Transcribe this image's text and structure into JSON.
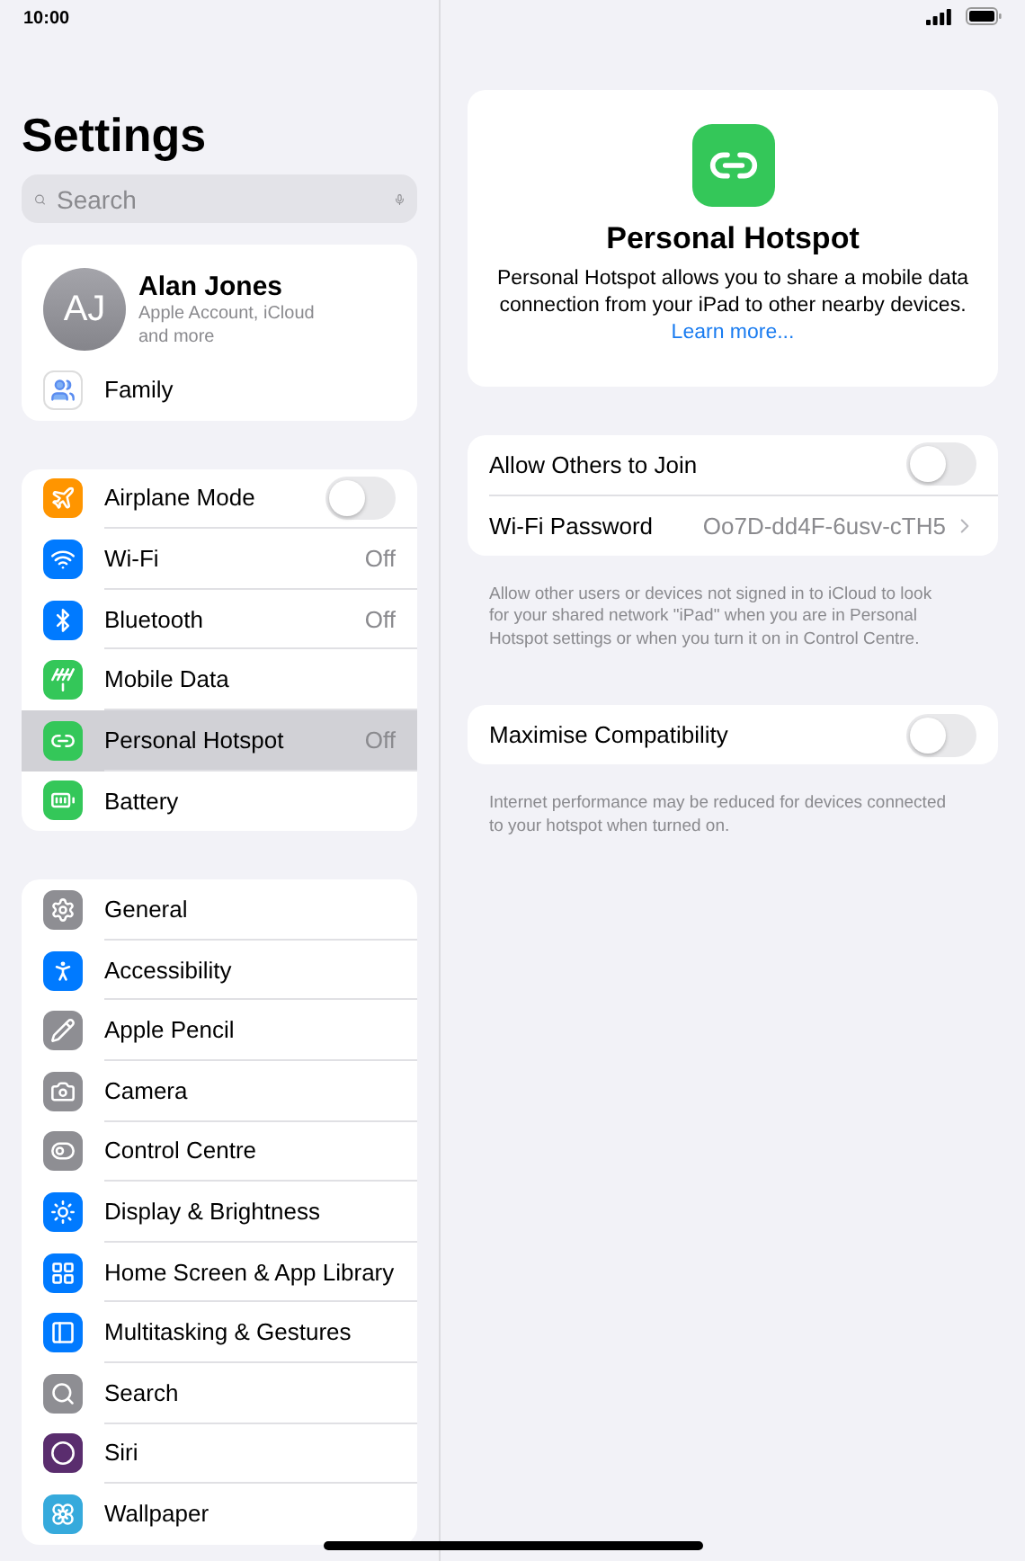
{
  "status_bar": {
    "time": "10:00"
  },
  "sidebar": {
    "title": "Settings",
    "search": {
      "placeholder": "Search"
    },
    "account": {
      "initials": "AJ",
      "name": "Alan Jones",
      "subtitle": "Apple Account, iCloud and more",
      "family": "Family"
    },
    "groups": [
      [
        {
          "kind": "toggle",
          "label": "Airplane Mode",
          "on": false,
          "selected": false
        },
        {
          "kind": "value",
          "label": "Wi-Fi",
          "value": "Off",
          "selected": false
        },
        {
          "kind": "value",
          "label": "Bluetooth",
          "value": "Off",
          "selected": false
        },
        {
          "kind": "value",
          "label": "Mobile Data",
          "selected": false
        },
        {
          "kind": "value",
          "label": "Personal Hotspot",
          "value": "Off",
          "selected": true
        },
        {
          "kind": "value",
          "label": "Battery",
          "selected": false
        }
      ],
      [
        {
          "kind": "value",
          "label": "General",
          "selected": false
        },
        {
          "kind": "value",
          "label": "Accessibility",
          "selected": false
        },
        {
          "kind": "value",
          "label": "Apple Pencil",
          "selected": false
        },
        {
          "kind": "value",
          "label": "Camera",
          "selected": false
        },
        {
          "kind": "value",
          "label": "Control Centre",
          "selected": false
        },
        {
          "kind": "value",
          "label": "Display & Brightness",
          "selected": false
        },
        {
          "kind": "value",
          "label": "Home Screen & App Library",
          "selected": false
        },
        {
          "kind": "value",
          "label": "Multitasking & Gestures",
          "selected": false
        },
        {
          "kind": "value",
          "label": "Search",
          "selected": false
        },
        {
          "kind": "value",
          "label": "Siri",
          "selected": false
        },
        {
          "kind": "value",
          "label": "Wallpaper",
          "selected": false
        }
      ]
    ]
  },
  "detail": {
    "header": {
      "title": "Personal Hotspot",
      "description": "Personal Hotspot allows you to share a mobile data connection from your iPad to other nearby devices.",
      "link": "Learn more..."
    },
    "sections": [
      {
        "rows": [
          {
            "kind": "toggle",
            "label": "Allow Others to Join",
            "on": false
          },
          {
            "kind": "value",
            "label": "Wi-Fi Password",
            "value": "Oo7D-dd4F-6usv-cTH5"
          }
        ],
        "footer": "Allow other users or devices not signed in to iCloud to look for your shared network \"iPad\" when you are in Personal Hotspot settings or when you turn it on in Control Centre."
      },
      {
        "rows": [
          {
            "kind": "toggle",
            "label": "Maximise Compatibility",
            "on": false
          }
        ],
        "footer": "Internet performance may be reduced for devices connected to your hotspot when turned on."
      }
    ]
  }
}
